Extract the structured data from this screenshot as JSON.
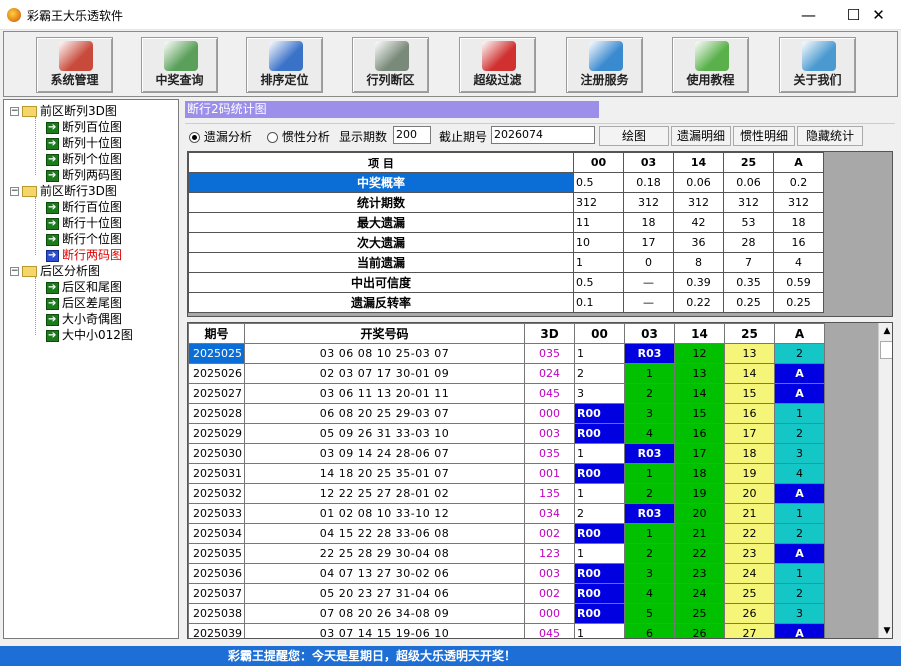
{
  "window": {
    "title": "彩霸王大乐透软件",
    "min": "—",
    "max": "☐",
    "close": "✕"
  },
  "toolbar": [
    {
      "label": "系统管理",
      "icon": "toolbox-icon",
      "color": "#c84a3a"
    },
    {
      "label": "中奖查询",
      "icon": "magnifier-icon",
      "color": "#5aa05a"
    },
    {
      "label": "排序定位",
      "icon": "compass-icon",
      "color": "#3a72c8"
    },
    {
      "label": "行列断区",
      "icon": "notepad-pencil-icon",
      "color": "#7a8a7a"
    },
    {
      "label": "超级过滤",
      "icon": "cubes-icon",
      "color": "#d03030"
    },
    {
      "label": "注册服务",
      "icon": "keys-icon",
      "color": "#3a8ad0"
    },
    {
      "label": "使用教程",
      "icon": "user-icon",
      "color": "#5ab04a"
    },
    {
      "label": "关于我们",
      "icon": "phone-icon",
      "color": "#4a9ad0"
    }
  ],
  "tree": [
    {
      "label": "前区断列3D图",
      "children": [
        "断列百位图",
        "断列十位图",
        "断列个位图",
        "断列两码图"
      ]
    },
    {
      "label": "前区断行3D图",
      "children": [
        "断行百位图",
        "断行十位图",
        "断行个位图",
        "断行两码图"
      ]
    },
    {
      "label": "后区分析图",
      "children": [
        "后区和尾图",
        "后区差尾图",
        "大小奇偶图",
        "大中小012图"
      ]
    }
  ],
  "tree_selected": "断行两码图",
  "panel": {
    "title": "断行2码统计图",
    "radio1": "遗漏分析",
    "radio2": "惯性分析",
    "periods_label": "显示期数",
    "periods_value": "200",
    "cutoff_label": "截止期号",
    "cutoff_value": "2026074",
    "btn_draw": "绘图",
    "btn_missing": "遗漏明细",
    "btn_inertia": "惯性明细",
    "btn_hide": "隐藏统计"
  },
  "stats": {
    "header": [
      "项    目",
      "00",
      "03",
      "14",
      "25",
      "A"
    ],
    "rows": [
      {
        "label": "中奖概率",
        "values": [
          "0.5",
          "0.18",
          "0.06",
          "0.06",
          "0.2"
        ]
      },
      {
        "label": "统计期数",
        "values": [
          "312",
          "312",
          "312",
          "312",
          "312"
        ]
      },
      {
        "label": "最大遗漏",
        "values": [
          "11",
          "18",
          "42",
          "53",
          "18"
        ]
      },
      {
        "label": "次大遗漏",
        "values": [
          "10",
          "17",
          "36",
          "28",
          "16"
        ]
      },
      {
        "label": "当前遗漏",
        "values": [
          "1",
          "0",
          "8",
          "7",
          "4"
        ]
      },
      {
        "label": "中出可信度",
        "values": [
          "0.5",
          "—",
          "0.39",
          "0.35",
          "0.59"
        ]
      },
      {
        "label": "遗漏反转率",
        "values": [
          "0.1",
          "—",
          "0.22",
          "0.25",
          "0.25"
        ]
      }
    ]
  },
  "draws": {
    "header": [
      "期号",
      "开奖号码",
      "3D",
      "00",
      "03",
      "14",
      "25",
      "A"
    ],
    "rows": [
      [
        "2025025",
        "03 06 08 10 25-03 07",
        "035",
        "1",
        "R03",
        "12",
        "13",
        "2"
      ],
      [
        "2025026",
        "02 03 07 17 30-01 09",
        "024",
        "2",
        "1",
        "13",
        "14",
        "A"
      ],
      [
        "2025027",
        "03 06 11 13 20-01 11",
        "045",
        "3",
        "2",
        "14",
        "15",
        "A"
      ],
      [
        "2025028",
        "06 08 20 25 29-03 07",
        "000",
        "R00",
        "3",
        "15",
        "16",
        "1"
      ],
      [
        "2025029",
        "05 09 26 31 33-03 10",
        "003",
        "R00",
        "4",
        "16",
        "17",
        "2"
      ],
      [
        "2025030",
        "03 09 14 24 28-06 07",
        "035",
        "1",
        "R03",
        "17",
        "18",
        "3"
      ],
      [
        "2025031",
        "14 18 20 25 35-01 07",
        "001",
        "R00",
        "1",
        "18",
        "19",
        "4"
      ],
      [
        "2025032",
        "12 22 25 27 28-01 02",
        "135",
        "1",
        "2",
        "19",
        "20",
        "A"
      ],
      [
        "2025033",
        "01 02 08 10 33-10 12",
        "034",
        "2",
        "R03",
        "20",
        "21",
        "1"
      ],
      [
        "2025034",
        "04 15 22 28 33-06 08",
        "002",
        "R00",
        "1",
        "21",
        "22",
        "2"
      ],
      [
        "2025035",
        "22 25 28 29 30-04 08",
        "123",
        "1",
        "2",
        "22",
        "23",
        "A"
      ],
      [
        "2025036",
        "04 07 13 27 30-02 06",
        "003",
        "R00",
        "3",
        "23",
        "24",
        "1"
      ],
      [
        "2025037",
        "05 20 23 27 31-04 06",
        "002",
        "R00",
        "4",
        "24",
        "25",
        "2"
      ],
      [
        "2025038",
        "07 08 20 26 34-08 09",
        "000",
        "R00",
        "5",
        "25",
        "26",
        "3"
      ],
      [
        "2025039",
        "03 07 14 15 19-06 10",
        "045",
        "1",
        "6",
        "26",
        "27",
        "A"
      ]
    ]
  },
  "status": "彩霸王提醒您：今天是星期日，超级大乐透明天开奖！",
  "colors": {
    "accent": "#1d6fd6",
    "hit": "#0000e0",
    "green": "#00c000",
    "yellow": "#f5f57a",
    "teal": "#14c6c6",
    "title_bar": "#9b8fea"
  }
}
